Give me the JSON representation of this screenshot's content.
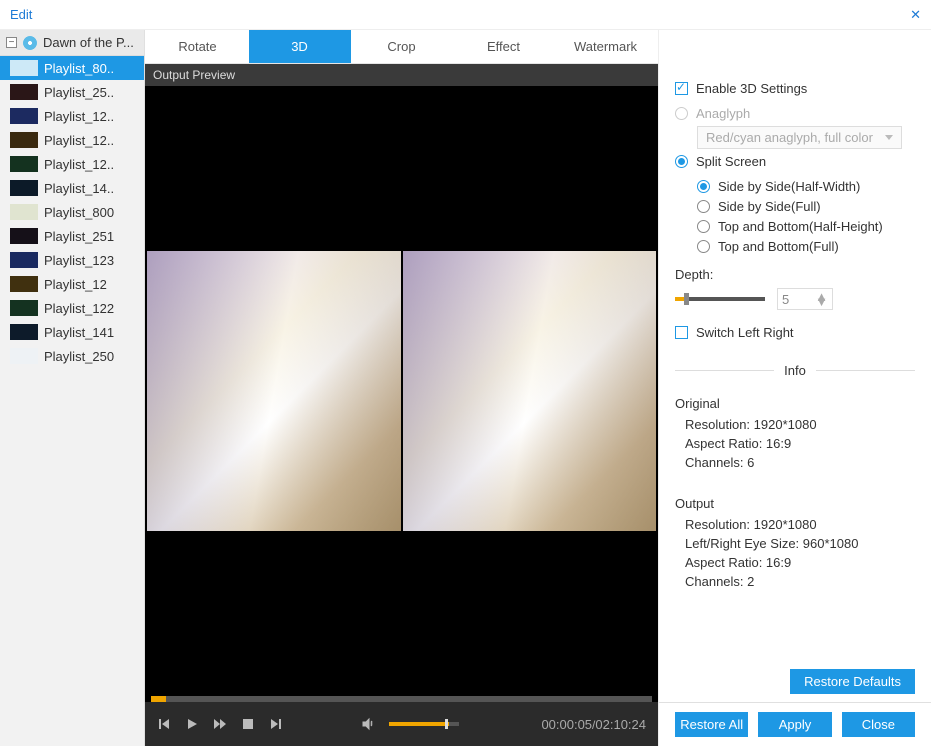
{
  "titlebar": {
    "title": "Edit"
  },
  "sidebar": {
    "root_title": "Dawn of the P...",
    "items": [
      {
        "label": "Playlist_80..",
        "thumb": "#cde9f7",
        "active": true
      },
      {
        "label": "Playlist_25..",
        "thumb": "#2a1617"
      },
      {
        "label": "Playlist_12..",
        "thumb": "#1c2a60"
      },
      {
        "label": "Playlist_12..",
        "thumb": "#3a2a10"
      },
      {
        "label": "Playlist_12..",
        "thumb": "#14321f"
      },
      {
        "label": "Playlist_14..",
        "thumb": "#0c1a28"
      },
      {
        "label": "Playlist_800",
        "thumb": "#e0e4d0"
      },
      {
        "label": "Playlist_251",
        "thumb": "#151018"
      },
      {
        "label": "Playlist_123",
        "thumb": "#1a2a60"
      },
      {
        "label": "Playlist_12",
        "thumb": "#40300f"
      },
      {
        "label": "Playlist_122",
        "thumb": "#143220"
      },
      {
        "label": "Playlist_141",
        "thumb": "#0d1b2a"
      },
      {
        "label": "Playlist_250",
        "thumb": "#eef2f5"
      }
    ]
  },
  "tabs": {
    "items": [
      "Rotate",
      "3D",
      "Crop",
      "Effect",
      "Watermark"
    ],
    "active_index": 1
  },
  "preview": {
    "header": "Output Preview",
    "time_current": "00:00:05",
    "time_total": "02:10:24"
  },
  "panel3d": {
    "enable_label": "Enable 3D Settings",
    "anaglyph_label": "Anaglyph",
    "anaglyph_select": "Red/cyan anaglyph, full color",
    "split_label": "Split Screen",
    "split_options": [
      "Side by Side(Half-Width)",
      "Side by Side(Full)",
      "Top and Bottom(Half-Height)",
      "Top and Bottom(Full)"
    ],
    "split_selected_index": 0,
    "depth_label": "Depth:",
    "depth_value": "5",
    "switch_lr_label": "Switch Left Right"
  },
  "info": {
    "heading": "Info",
    "original": {
      "title": "Original",
      "resolution": "Resolution: 1920*1080",
      "aspect": "Aspect Ratio: 16:9",
      "channels": "Channels: 6"
    },
    "output": {
      "title": "Output",
      "resolution": "Resolution: 1920*1080",
      "eye_size": "Left/Right Eye Size: 960*1080",
      "aspect": "Aspect Ratio: 16:9",
      "channels": "Channels: 2"
    }
  },
  "buttons": {
    "restore_defaults": "Restore Defaults",
    "restore_all": "Restore All",
    "apply": "Apply",
    "close": "Close"
  }
}
